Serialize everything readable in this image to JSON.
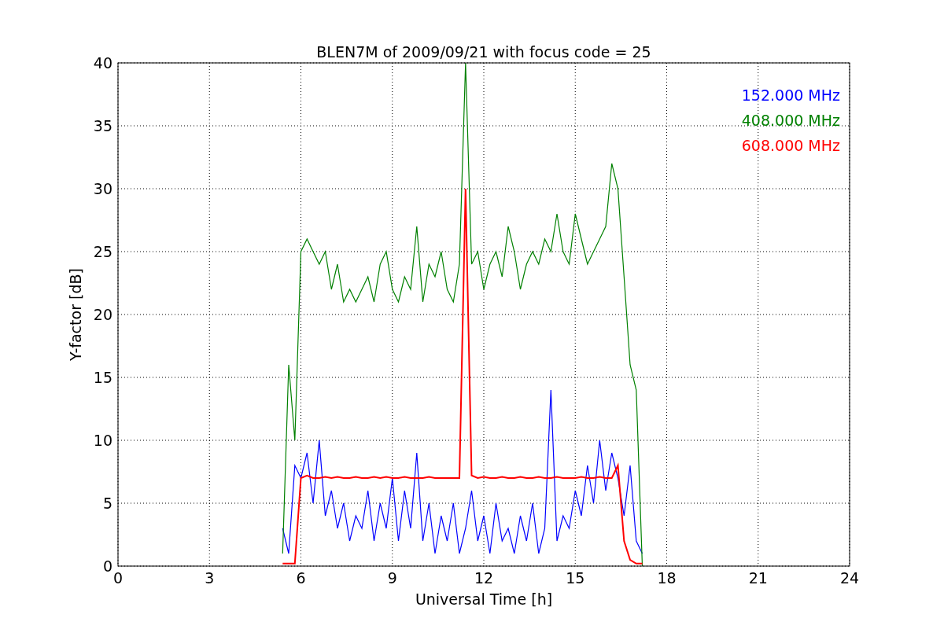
{
  "chart_data": {
    "type": "line",
    "title": "BLEN7M of 2009/09/21 with focus code = 25",
    "xlabel": "Universal Time [h]",
    "ylabel": "Y-factor [dB]",
    "grid": true,
    "xlim": [
      0,
      24
    ],
    "ylim": [
      0,
      40
    ],
    "xticks": [
      0,
      3,
      6,
      9,
      12,
      15,
      18,
      21,
      24
    ],
    "yticks": [
      0,
      5,
      10,
      15,
      20,
      25,
      30,
      35,
      40
    ],
    "x": [
      5.4,
      5.6,
      5.8,
      6.0,
      6.2,
      6.4,
      6.6,
      6.8,
      7.0,
      7.2,
      7.4,
      7.6,
      7.8,
      8.0,
      8.2,
      8.4,
      8.6,
      8.8,
      9.0,
      9.2,
      9.4,
      9.6,
      9.8,
      10.0,
      10.2,
      10.4,
      10.6,
      10.8,
      11.0,
      11.2,
      11.4,
      11.6,
      11.8,
      12.0,
      12.2,
      12.4,
      12.6,
      12.8,
      13.0,
      13.2,
      13.4,
      13.6,
      13.8,
      14.0,
      14.2,
      14.4,
      14.6,
      14.8,
      15.0,
      15.2,
      15.4,
      15.6,
      15.8,
      16.0,
      16.2,
      16.4,
      16.6,
      16.8,
      17.0,
      17.2
    ],
    "series": [
      {
        "name": "152.000 MHz",
        "color": "#0000ff",
        "values": [
          3,
          1,
          8,
          7,
          9,
          5,
          10,
          4,
          6,
          3,
          5,
          2,
          4,
          3,
          6,
          2,
          5,
          3,
          7,
          2,
          6,
          3,
          9,
          2,
          5,
          1,
          4,
          2,
          5,
          1,
          3,
          6,
          2,
          4,
          1,
          5,
          2,
          3,
          1,
          4,
          2,
          5,
          1,
          3,
          14,
          2,
          4,
          3,
          6,
          4,
          8,
          5,
          10,
          6,
          9,
          7,
          4,
          8,
          2,
          1
        ]
      },
      {
        "name": "408.000 MHz",
        "color": "#008000",
        "values": [
          1,
          16,
          10,
          25,
          26,
          25,
          24,
          25,
          22,
          24,
          21,
          22,
          21,
          22,
          23,
          21,
          24,
          25,
          22,
          21,
          23,
          22,
          27,
          21,
          24,
          23,
          25,
          22,
          21,
          24,
          40,
          24,
          25,
          22,
          24,
          25,
          23,
          27,
          25,
          22,
          24,
          25,
          24,
          26,
          25,
          28,
          25,
          24,
          28,
          26,
          24,
          25,
          26,
          27,
          32,
          30,
          23,
          16,
          14,
          0
        ]
      },
      {
        "name": "608.000 MHz",
        "color": "#ff0000",
        "values": [
          0.2,
          0.2,
          0.2,
          7,
          7.2,
          7,
          7,
          7.1,
          7,
          7.1,
          7,
          7,
          7.1,
          7,
          7,
          7.1,
          7,
          7.1,
          7,
          7,
          7.1,
          7,
          7,
          7,
          7.1,
          7,
          7,
          7,
          7,
          7,
          30,
          7.2,
          7,
          7.1,
          7,
          7,
          7.1,
          7,
          7,
          7.1,
          7,
          7,
          7.1,
          7,
          7,
          7.1,
          7,
          7,
          7,
          7.1,
          7,
          7,
          7.1,
          7,
          7,
          8,
          2,
          0.5,
          0.2,
          0.2
        ]
      }
    ]
  }
}
